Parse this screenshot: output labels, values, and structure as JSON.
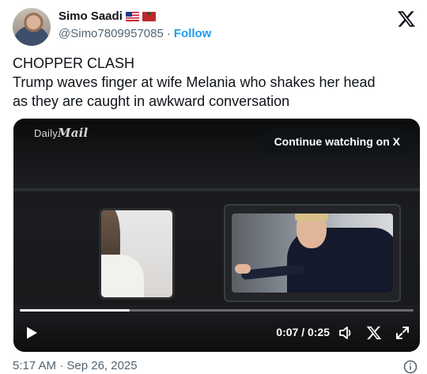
{
  "author": {
    "name": "Simo Saadi",
    "handle": "@Simo7809957085",
    "separator": "·",
    "follow_label": "Follow",
    "flags": [
      "us-flag",
      "morocco-flag"
    ]
  },
  "tweet": {
    "lines": [
      "CHOPPER CLASH",
      "Trump waves finger at wife Melania who shakes her head",
      "as they are caught in awkward conversation"
    ]
  },
  "video": {
    "watermark_prefix": "Daily",
    "watermark_brand": "Mail",
    "continue_label": "Continue watching on X",
    "time_label": "0:07 / 0:25",
    "progress": 0.28,
    "icons": [
      "play-icon",
      "volume-icon",
      "x-logo-icon",
      "fullscreen-icon"
    ]
  },
  "footer": {
    "timestamp": "5:17 AM · Sep 26, 2025"
  },
  "colors": {
    "text": "#0f1419",
    "secondary": "#536471",
    "accent": "#1d9bf0"
  }
}
